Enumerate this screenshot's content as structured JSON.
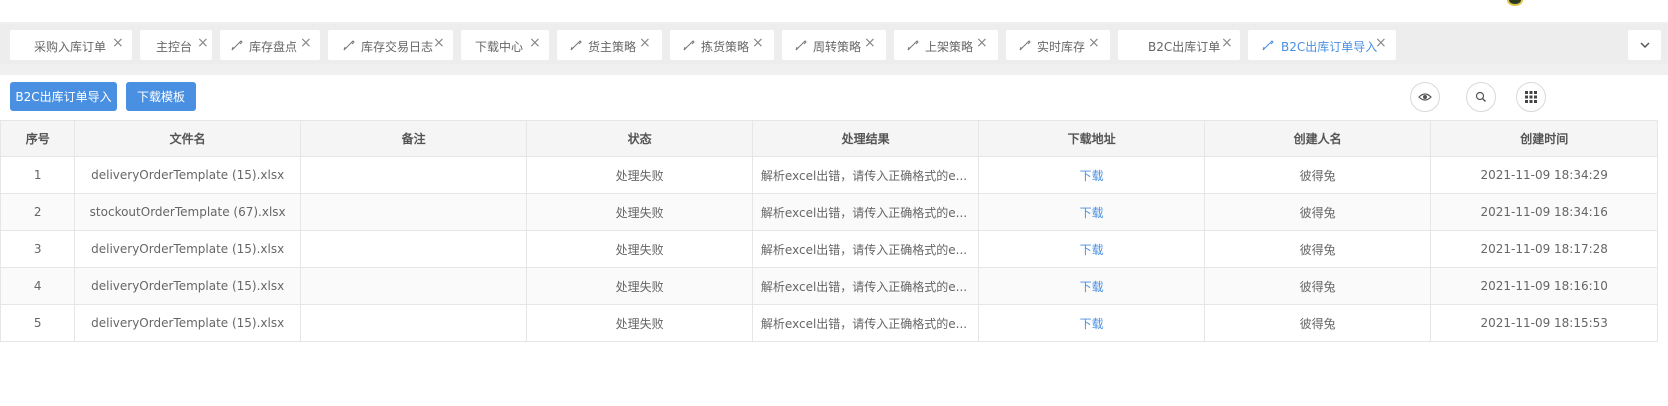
{
  "tabs": [
    {
      "label": "采购入库订单",
      "icon": "none"
    },
    {
      "label": "主控台",
      "icon": "none"
    },
    {
      "label": "库存盘点",
      "icon": "pen-icon"
    },
    {
      "label": "库存交易日志",
      "icon": "pen-icon"
    },
    {
      "label": "下载中心",
      "icon": "none"
    },
    {
      "label": "货主策略",
      "icon": "pen-icon"
    },
    {
      "label": "拣货策略",
      "icon": "pen-icon"
    },
    {
      "label": "周转策略",
      "icon": "pen-icon"
    },
    {
      "label": "上架策略",
      "icon": "pen-icon"
    },
    {
      "label": "实时库存",
      "icon": "pen-icon"
    },
    {
      "label": "B2C出库订单",
      "icon": "none"
    },
    {
      "label": "B2C出库订单导入",
      "icon": "pen-icon",
      "active": true
    }
  ],
  "toolbar": {
    "import_label": "B2C出库订单导入",
    "template_label": "下载模板"
  },
  "table": {
    "headers": [
      "序号",
      "文件名",
      "备注",
      "状态",
      "处理结果",
      "下载地址",
      "创建人名",
      "创建时间"
    ],
    "rows": [
      {
        "no": "1",
        "file": "deliveryOrderTemplate (15).xlsx",
        "note": "",
        "status": "处理失败",
        "result": "解析excel出错，请传入正确格式的e...",
        "download": "下载",
        "creator": "彼得兔",
        "time": "2021-11-09 18:34:29"
      },
      {
        "no": "2",
        "file": "stockoutOrderTemplate (67).xlsx",
        "note": "",
        "status": "处理失败",
        "result": "解析excel出错，请传入正确格式的e...",
        "download": "下载",
        "creator": "彼得兔",
        "time": "2021-11-09 18:34:16"
      },
      {
        "no": "3",
        "file": "deliveryOrderTemplate (15).xlsx",
        "note": "",
        "status": "处理失败",
        "result": "解析excel出错，请传入正确格式的e...",
        "download": "下载",
        "creator": "彼得兔",
        "time": "2021-11-09 18:17:28"
      },
      {
        "no": "4",
        "file": "deliveryOrderTemplate (15).xlsx",
        "note": "",
        "status": "处理失败",
        "result": "解析excel出错，请传入正确格式的e...",
        "download": "下载",
        "creator": "彼得兔",
        "time": "2021-11-09 18:16:10"
      },
      {
        "no": "5",
        "file": "deliveryOrderTemplate (15).xlsx",
        "note": "",
        "status": "处理失败",
        "result": "解析excel出错，请传入正确格式的e...",
        "download": "下载",
        "creator": "彼得兔",
        "time": "2021-11-09 18:15:53"
      }
    ]
  },
  "colors": {
    "accent": "#4a90e2",
    "link": "#4a90e2"
  }
}
